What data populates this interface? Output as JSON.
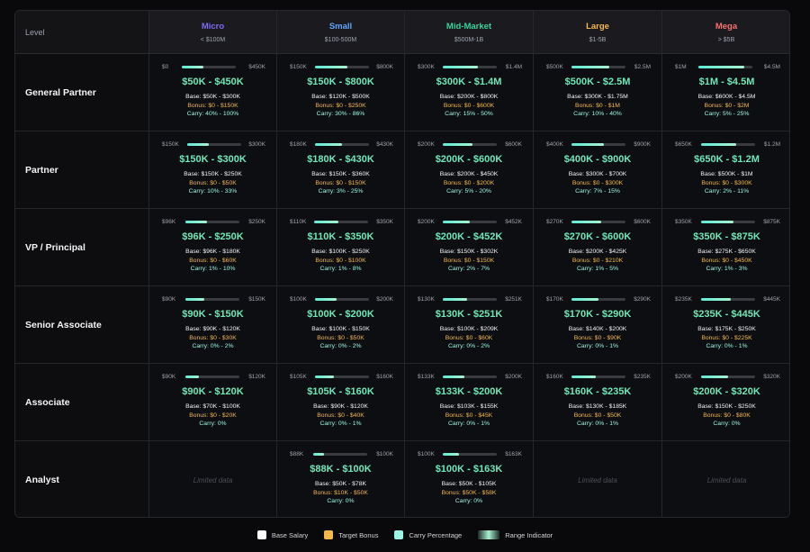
{
  "header": {
    "level_label": "Level",
    "tiers": [
      {
        "name": "Micro",
        "range": "< $100M",
        "color": "#7c6af0"
      },
      {
        "name": "Small",
        "range": "$100-500M",
        "color": "#60a5fa"
      },
      {
        "name": "Mid-Market",
        "range": "$500M-1B",
        "color": "#34d399"
      },
      {
        "name": "Large",
        "range": "$1-5B",
        "color": "#f5b94a"
      },
      {
        "name": "Mega",
        "range": "> $5B",
        "color": "#f87171"
      }
    ]
  },
  "rows": [
    {
      "role": "General Partner",
      "cells": [
        {
          "min": "$0",
          "max": "$450K",
          "fill": 0.4,
          "total": "$50K - $450K",
          "base": "Base: $50K - $300K",
          "bonus": "Bonus: $0 - $150K",
          "carry": "Carry: 40% - 100%"
        },
        {
          "min": "$150K",
          "max": "$800K",
          "fill": 0.6,
          "total": "$150K - $800K",
          "base": "Base: $120K - $500K",
          "bonus": "Bonus: $0 - $250K",
          "carry": "Carry: 30% - 86%"
        },
        {
          "min": "$300K",
          "max": "$1.4M",
          "fill": 0.65,
          "total": "$300K - $1.4M",
          "base": "Base: $200K - $800K",
          "bonus": "Bonus: $0 - $600K",
          "carry": "Carry: 15% - 50%"
        },
        {
          "min": "$500K",
          "max": "$2.5M",
          "fill": 0.7,
          "total": "$500K - $2.5M",
          "base": "Base: $300K - $1.75M",
          "bonus": "Bonus: $0 - $1M",
          "carry": "Carry: 10% - 40%"
        },
        {
          "min": "$1M",
          "max": "$4.5M",
          "fill": 0.85,
          "total": "$1M - $4.5M",
          "base": "Base: $600K - $4.5M",
          "bonus": "Bonus: $0 - $2M",
          "carry": "Carry: 5% - 25%"
        }
      ]
    },
    {
      "role": "Partner",
      "cells": [
        {
          "min": "$150K",
          "max": "$300K",
          "fill": 0.4,
          "total": "$150K - $300K",
          "base": "Base: $150K - $250K",
          "bonus": "Bonus: $0 - $50K",
          "carry": "Carry: 10% - 33%"
        },
        {
          "min": "$180K",
          "max": "$430K",
          "fill": 0.5,
          "total": "$180K - $430K",
          "base": "Base: $150K - $360K",
          "bonus": "Bonus: $0 - $150K",
          "carry": "Carry: 3% - 25%"
        },
        {
          "min": "$200K",
          "max": "$600K",
          "fill": 0.55,
          "total": "$200K - $600K",
          "base": "Base: $200K - $450K",
          "bonus": "Bonus: $0 - $200K",
          "carry": "Carry: 5% - 20%"
        },
        {
          "min": "$400K",
          "max": "$900K",
          "fill": 0.6,
          "total": "$400K - $900K",
          "base": "Base: $300K - $700K",
          "bonus": "Bonus: $0 - $300K",
          "carry": "Carry: 7% - 15%"
        },
        {
          "min": "$650K",
          "max": "$1.2M",
          "fill": 0.65,
          "total": "$650K - $1.2M",
          "base": "Base: $500K - $1M",
          "bonus": "Bonus: $0 - $300K",
          "carry": "Carry: 2% - 11%"
        }
      ]
    },
    {
      "role": "VP / Principal",
      "cells": [
        {
          "min": "$96K",
          "max": "$250K",
          "fill": 0.4,
          "total": "$96K - $250K",
          "base": "Base: $96K - $180K",
          "bonus": "Bonus: $0 - $60K",
          "carry": "Carry: 1% - 10%"
        },
        {
          "min": "$110K",
          "max": "$350K",
          "fill": 0.45,
          "total": "$110K - $350K",
          "base": "Base: $100K - $250K",
          "bonus": "Bonus: $0 - $100K",
          "carry": "Carry: 1% - 8%"
        },
        {
          "min": "$200K",
          "max": "$452K",
          "fill": 0.5,
          "total": "$200K - $452K",
          "base": "Base: $150K - $302K",
          "bonus": "Bonus: $0 - $150K",
          "carry": "Carry: 2% - 7%"
        },
        {
          "min": "$270K",
          "max": "$600K",
          "fill": 0.55,
          "total": "$270K - $600K",
          "base": "Base: $200K - $425K",
          "bonus": "Bonus: $0 - $210K",
          "carry": "Carry: 1% - 5%"
        },
        {
          "min": "$350K",
          "max": "$875K",
          "fill": 0.6,
          "total": "$350K - $875K",
          "base": "Base: $275K - $650K",
          "bonus": "Bonus: $0 - $450K",
          "carry": "Carry: 1% - 3%"
        }
      ]
    },
    {
      "role": "Senior Associate",
      "cells": [
        {
          "min": "$90K",
          "max": "$150K",
          "fill": 0.35,
          "total": "$90K - $150K",
          "base": "Base: $90K - $120K",
          "bonus": "Bonus: $0 - $30K",
          "carry": "Carry: 0% - 2%"
        },
        {
          "min": "$100K",
          "max": "$200K",
          "fill": 0.4,
          "total": "$100K - $200K",
          "base": "Base: $100K - $150K",
          "bonus": "Bonus: $0 - $50K",
          "carry": "Carry: 0% - 2%"
        },
        {
          "min": "$130K",
          "max": "$251K",
          "fill": 0.45,
          "total": "$130K - $251K",
          "base": "Base: $100K - $209K",
          "bonus": "Bonus: $0 - $60K",
          "carry": "Carry: 0% - 2%"
        },
        {
          "min": "$170K",
          "max": "$290K",
          "fill": 0.5,
          "total": "$170K - $290K",
          "base": "Base: $140K - $200K",
          "bonus": "Bonus: $0 - $90K",
          "carry": "Carry: 0% - 1%"
        },
        {
          "min": "$235K",
          "max": "$445K",
          "fill": 0.55,
          "total": "$235K - $445K",
          "base": "Base: $175K - $250K",
          "bonus": "Bonus: $0 - $225K",
          "carry": "Carry: 0% - 1%"
        }
      ]
    },
    {
      "role": "Associate",
      "cells": [
        {
          "min": "$90K",
          "max": "$120K",
          "fill": 0.25,
          "total": "$90K - $120K",
          "base": "Base: $70K - $100K",
          "bonus": "Bonus: $0 - $20K",
          "carry": "Carry: 0%"
        },
        {
          "min": "$105K",
          "max": "$160K",
          "fill": 0.35,
          "total": "$105K - $160K",
          "base": "Base: $90K - $120K",
          "bonus": "Bonus: $0 - $40K",
          "carry": "Carry: 0% - 1%"
        },
        {
          "min": "$133K",
          "max": "$200K",
          "fill": 0.4,
          "total": "$133K - $200K",
          "base": "Base: $103K - $155K",
          "bonus": "Bonus: $0 - $45K",
          "carry": "Carry: 0% - 1%"
        },
        {
          "min": "$160K",
          "max": "$235K",
          "fill": 0.45,
          "total": "$160K - $235K",
          "base": "Base: $130K - $185K",
          "bonus": "Bonus: $0 - $50K",
          "carry": "Carry: 0% - 1%"
        },
        {
          "min": "$200K",
          "max": "$320K",
          "fill": 0.5,
          "total": "$200K - $320K",
          "base": "Base: $150K - $250K",
          "bonus": "Bonus: $0 - $80K",
          "carry": "Carry: 0%"
        }
      ]
    },
    {
      "role": "Analyst",
      "cells": [
        {
          "empty": "Limited data"
        },
        {
          "min": "$88K",
          "max": "$100K",
          "fill": 0.2,
          "total": "$88K - $100K",
          "base": "Base: $50K - $78K",
          "bonus": "Bonus: $10K - $50K",
          "carry": "Carry: 0%"
        },
        {
          "min": "$100K",
          "max": "$163K",
          "fill": 0.3,
          "total": "$100K - $163K",
          "base": "Base: $50K - $105K",
          "bonus": "Bonus: $50K - $58K",
          "carry": "Carry: 0%"
        },
        {
          "empty": "Limited data"
        },
        {
          "empty": "Limited data"
        }
      ]
    }
  ],
  "legend": [
    {
      "label": "Base Salary",
      "color": "#ffffff",
      "kind": "square"
    },
    {
      "label": "Target Bonus",
      "color": "#f5b94a",
      "kind": "square"
    },
    {
      "label": "Carry Percentage",
      "color": "#99f6e4",
      "kind": "square"
    },
    {
      "label": "Range Indicator",
      "color": "#a7f3d0",
      "kind": "range"
    }
  ]
}
